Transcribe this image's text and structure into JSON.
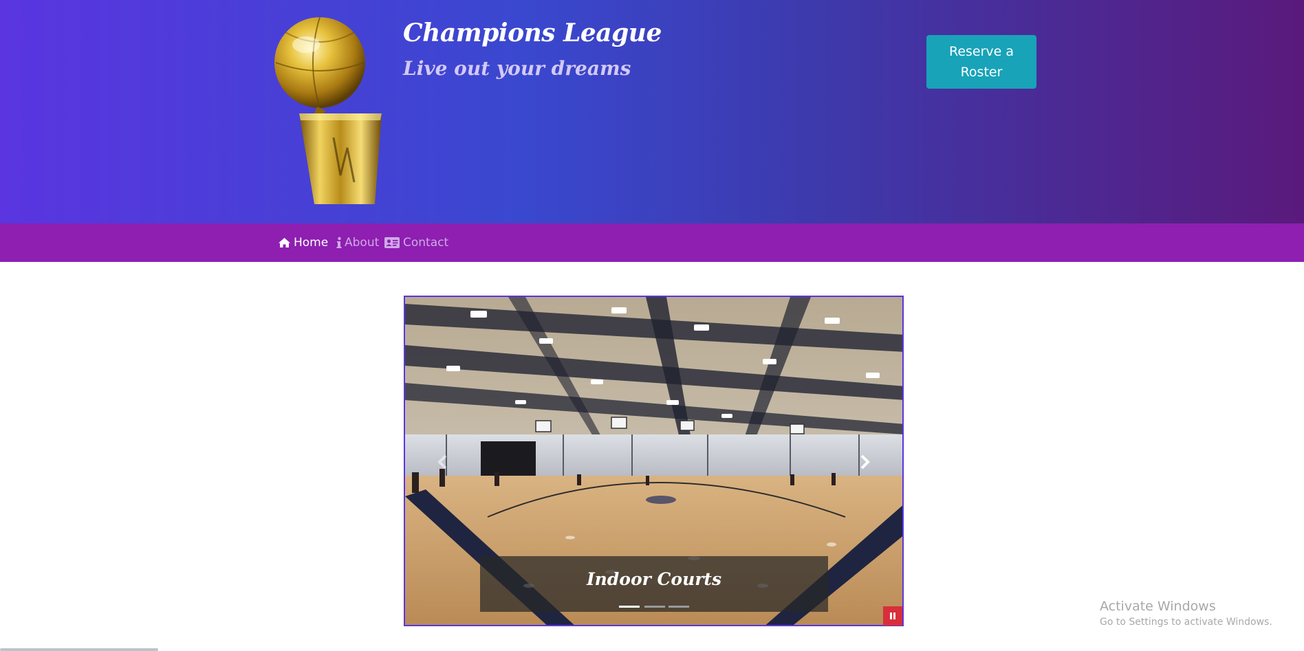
{
  "header": {
    "title": "Champions League",
    "tagline": "Live out your dreams",
    "reserve_button": "Reserve a Roster",
    "trophy_icon": "trophy-logo"
  },
  "nav": {
    "items": [
      {
        "label": "Home",
        "icon": "home-icon",
        "active": true
      },
      {
        "label": "About",
        "icon": "info-icon",
        "active": false
      },
      {
        "label": "Contact",
        "icon": "contact-card-icon",
        "active": false
      }
    ]
  },
  "carousel": {
    "caption": "Indoor Courts",
    "slide_count": 3,
    "active_slide": 1,
    "controls": {
      "prev": "chevron-left-icon",
      "next": "chevron-right-icon",
      "pause": "pause-icon"
    }
  },
  "watermark": {
    "title": "Activate Windows",
    "subtitle": "Go to Settings to activate Windows."
  },
  "colors": {
    "header_gradient": [
      "#5a35e0",
      "#3a48cf",
      "#5a1a7c"
    ],
    "navbar": "#8e1fb1",
    "button": "#18a3b9",
    "carousel_border": "#5a35e0",
    "pause": "#d82f3b"
  }
}
